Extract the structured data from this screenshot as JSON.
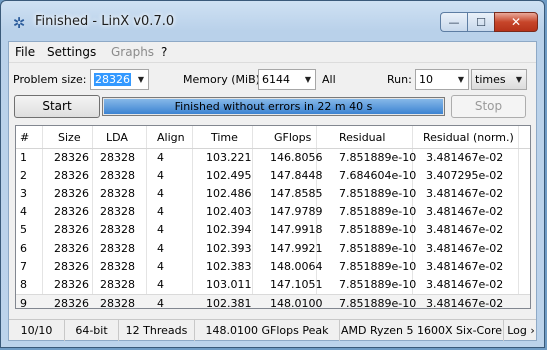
{
  "window": {
    "title": "Finished - LinX v0.7.0",
    "min_glyph": "—",
    "max_glyph": "☐",
    "close_glyph": "✕"
  },
  "menu": [
    "File",
    "Settings",
    "Graphs",
    "?"
  ],
  "settings": {
    "problem_size_label": "Problem size:",
    "problem_size_value": "28326",
    "memory_label": "Memory (MiB):",
    "memory_value": "6144",
    "all_label": "All",
    "run_label": "Run:",
    "run_value": "10",
    "run_unit": "times"
  },
  "controls": {
    "start_label": "Start",
    "stop_label": "Stop",
    "progress_text": "Finished without errors in 22 m 40 s",
    "progress_fraction": 1.0
  },
  "table": {
    "columns": [
      "#",
      "Size",
      "LDA",
      "Align",
      "Time",
      "GFlops",
      "Residual",
      "Residual (norm.)"
    ],
    "rows": [
      [
        "1",
        "28326",
        "28328",
        "4",
        "103.221",
        "146.8056",
        "7.851889e-10",
        "3.481467e-02"
      ],
      [
        "2",
        "28326",
        "28328",
        "4",
        "102.495",
        "147.8448",
        "7.684604e-10",
        "3.407295e-02"
      ],
      [
        "3",
        "28326",
        "28328",
        "4",
        "102.486",
        "147.8585",
        "7.851889e-10",
        "3.481467e-02"
      ],
      [
        "4",
        "28326",
        "28328",
        "4",
        "102.403",
        "147.9789",
        "7.851889e-10",
        "3.481467e-02"
      ],
      [
        "5",
        "28326",
        "28328",
        "4",
        "102.394",
        "147.9918",
        "7.851889e-10",
        "3.481467e-02"
      ],
      [
        "6",
        "28326",
        "28328",
        "4",
        "102.393",
        "147.9921",
        "7.851889e-10",
        "3.481467e-02"
      ],
      [
        "7",
        "28326",
        "28328",
        "4",
        "102.383",
        "148.0064",
        "7.851889e-10",
        "3.481467e-02"
      ],
      [
        "8",
        "28326",
        "28328",
        "4",
        "103.011",
        "147.1051",
        "7.851889e-10",
        "3.481467e-02"
      ],
      [
        "9",
        "28326",
        "28328",
        "4",
        "102.381",
        "148.0100",
        "7.851889e-10",
        "3.481467e-02"
      ],
      [
        "10",
        "28326",
        "28328",
        "4",
        "102.391",
        "147.9957",
        "7.851889e-10",
        "3.481467e-02"
      ]
    ]
  },
  "status": {
    "runs": "10/10",
    "arch": "64-bit",
    "threads": "12 Threads",
    "peak": "148.0100 GFlops Peak",
    "cpu": "AMD Ryzen 5 1600X Six-Core",
    "log": "Log ›"
  }
}
